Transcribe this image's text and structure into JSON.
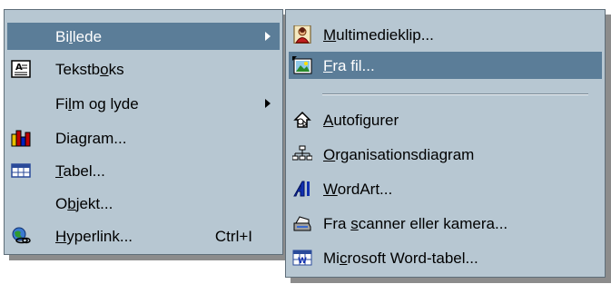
{
  "main_menu": {
    "items": [
      {
        "pre": "Bi",
        "u": "l",
        "post": "lede",
        "has_submenu": true,
        "highlighted": true,
        "icon": "none"
      },
      {
        "pre": "Tekstb",
        "u": "o",
        "post": "ks",
        "has_submenu": false,
        "icon": "textbox-icon"
      },
      {
        "pre": "Fi",
        "u": "l",
        "post": "m og lyde",
        "has_submenu": true,
        "icon": "none"
      },
      {
        "pre": "Dia",
        "u": "g",
        "post": "ram...",
        "has_submenu": false,
        "icon": "chart-icon"
      },
      {
        "pre": "",
        "u": "T",
        "post": "abel...",
        "has_submenu": false,
        "icon": "table-icon"
      },
      {
        "pre": "O",
        "u": "b",
        "post": "jekt...",
        "has_submenu": false,
        "icon": "none"
      },
      {
        "pre": "",
        "u": "H",
        "post": "yperlink...",
        "shortcut": "Ctrl+I",
        "has_submenu": false,
        "icon": "hyperlink-globe-icon"
      }
    ]
  },
  "sub_menu": {
    "items": [
      {
        "pre": "",
        "u": "M",
        "post": "ultimedieklip...",
        "icon": "clipart-icon"
      },
      {
        "pre": "",
        "u": "F",
        "post": "ra fil...",
        "selected": true,
        "icon": "picture-from-file-icon"
      },
      {
        "pre": "",
        "u": "A",
        "post": "utofigurer",
        "icon": "autoshapes-icon"
      },
      {
        "pre": "",
        "u": "O",
        "post": "rganisationsdiagram",
        "icon": "org-chart-icon"
      },
      {
        "pre": "",
        "u": "W",
        "post": "ordArt...",
        "icon": "wordart-icon"
      },
      {
        "pre": "Fra ",
        "u": "s",
        "post": "canner eller kamera...",
        "icon": "scanner-camera-icon"
      },
      {
        "pre": "Mi",
        "u": "c",
        "post": "rosoft Word-tabel...",
        "icon": "word-table-icon"
      }
    ]
  },
  "colors": {
    "menu_bg": "#b7c7d2",
    "highlight": "#5b7d98",
    "shadow": "#8c8c8c"
  }
}
